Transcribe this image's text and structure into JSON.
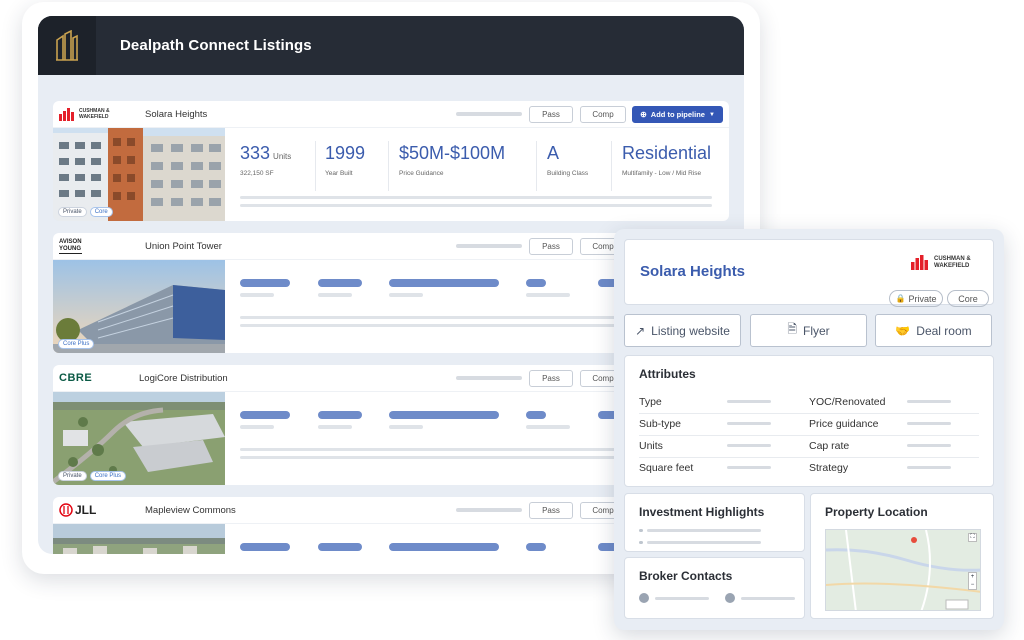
{
  "app": {
    "title": "Dealpath Connect Listings"
  },
  "listings": [
    {
      "broker": "Cushman & Wakefield",
      "broker_logo_text": [
        "CUSHMAN &",
        "WAKEFIELD"
      ],
      "name": "Solara Heights",
      "pass_label": "Pass",
      "comp_label": "Comp",
      "pipeline_label": "Add to pipeline",
      "tags": [
        "Private",
        "Core"
      ],
      "stats": [
        {
          "value": "333",
          "unit": "Units",
          "sub": "322,150 SF"
        },
        {
          "value": "1999",
          "sub": "Year Built"
        },
        {
          "value": "$50M-$100M",
          "sub": "Price Guidance"
        },
        {
          "value": "A",
          "sub": "Building Class"
        },
        {
          "value": "Residential",
          "sub": "Multifamily - Low / Mid Rise"
        }
      ]
    },
    {
      "broker": "Avison Young",
      "broker_logo_text": [
        "AVISON",
        "YOUNG"
      ],
      "name": "Union Point Tower",
      "pass_label": "Pass",
      "comp_label": "Comp",
      "tags": [
        "Core Plus"
      ]
    },
    {
      "broker": "CBRE",
      "broker_logo_text": [
        "CBRE"
      ],
      "name": "LogiCore Distribution",
      "pass_label": "Pass",
      "comp_label": "Comp",
      "tags": [
        "Private",
        "Core Plus"
      ]
    },
    {
      "broker": "JLL",
      "broker_logo_text": [
        "JLL"
      ],
      "name": "Mapleview Commons",
      "pass_label": "Pass",
      "comp_label": "Comp"
    }
  ],
  "detail": {
    "title": "Solara Heights",
    "broker_logo_text": [
      "CUSHMAN &",
      "WAKEFIELD"
    ],
    "tags": [
      "Private",
      "Core"
    ],
    "actions": [
      "Listing website",
      "Flyer",
      "Deal room"
    ],
    "attributes_title": "Attributes",
    "attributes_left": [
      "Type",
      "Sub-type",
      "Units",
      "Square feet"
    ],
    "attributes_right": [
      "YOC/Renovated",
      "Price guidance",
      "Cap rate",
      "Strategy"
    ],
    "highlights_title": "Investment Highlights",
    "location_title": "Property Location",
    "contacts_title": "Broker Contacts"
  },
  "colors": {
    "accent": "#3457b6",
    "value_text": "#3b5cad",
    "topbar": "#262c36",
    "cw_red": "#e4202a"
  }
}
